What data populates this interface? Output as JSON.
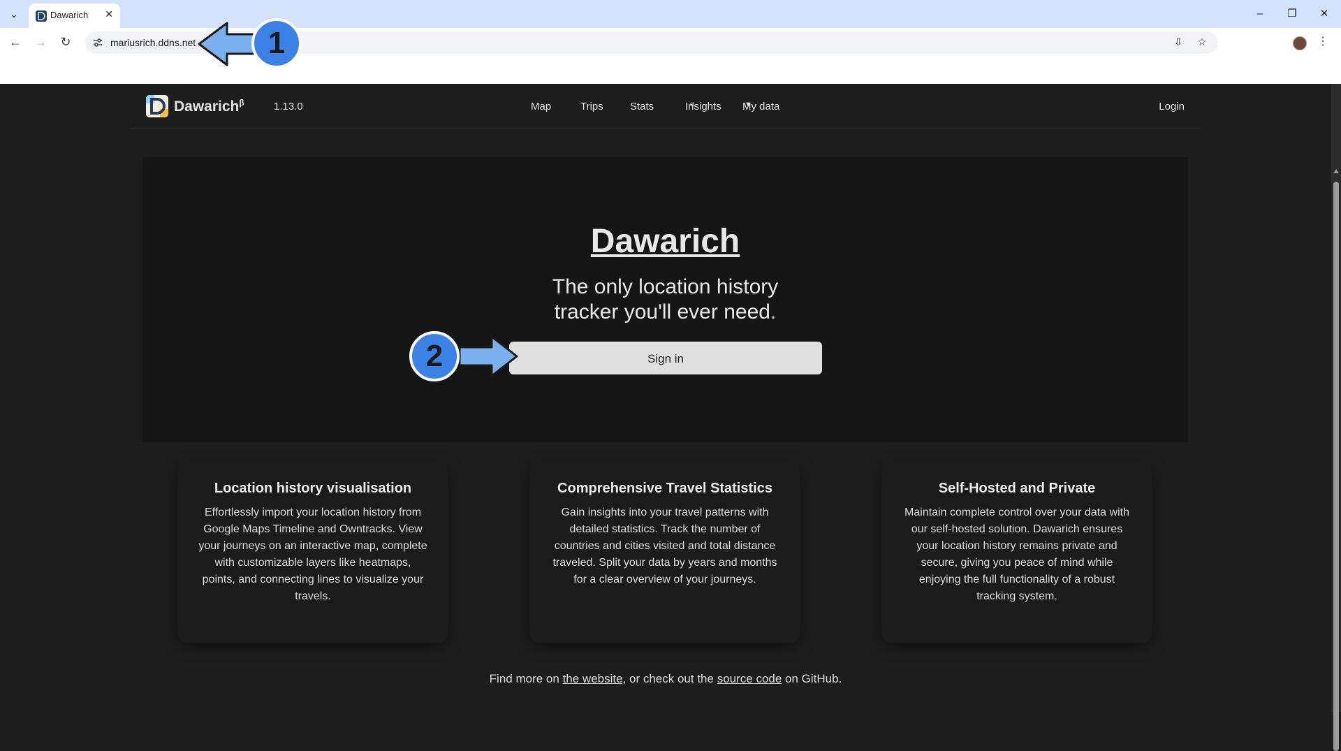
{
  "browser": {
    "tab_title": "Dawarich",
    "url": "mariusrich.ddns.net"
  },
  "navbar": {
    "brand": "Dawarich",
    "brand_sup": "β",
    "version": "1.13.0",
    "menu": {
      "map": "Map",
      "trips": "Trips",
      "stats": "Stats",
      "insights": "Insights",
      "insights_sup": "α",
      "my_data": "My data"
    },
    "login": "Login"
  },
  "hero": {
    "title": "Dawarich",
    "subtitle_line1": "The only location history",
    "subtitle_line2": "tracker you'll ever need.",
    "signin_label": "Sign in"
  },
  "features": [
    {
      "title": "Location history visualisation",
      "text": "Effortlessly import your location history from Google Maps Timeline and Owntracks. View your journeys on an interactive map, complete with customizable layers like heatmaps, points, and connecting lines to visualize your travels."
    },
    {
      "title": "Comprehensive Travel Statistics",
      "text": "Gain insights into your travel patterns with detailed statistics. Track the number of countries and cities visited and total distance traveled. Split your data by years and months for a clear overview of your journeys."
    },
    {
      "title": "Self-Hosted and Private",
      "text": "Maintain complete control over your data with our self-hosted solution. Dawarich ensures your location history remains private and secure, giving you peace of mind while enjoying the full functionality of a robust tracking system."
    }
  ],
  "footer": {
    "prefix": "Find more on ",
    "website_link": "the website",
    "middle": ", or check out the ",
    "source_link": "source code",
    "suffix": " on GitHub."
  },
  "annotations": {
    "step1": "1",
    "step2": "2"
  },
  "colors": {
    "annotation_blue": "#3b82e6",
    "page_background": "#1d1d1d",
    "hero_background": "#151515"
  }
}
